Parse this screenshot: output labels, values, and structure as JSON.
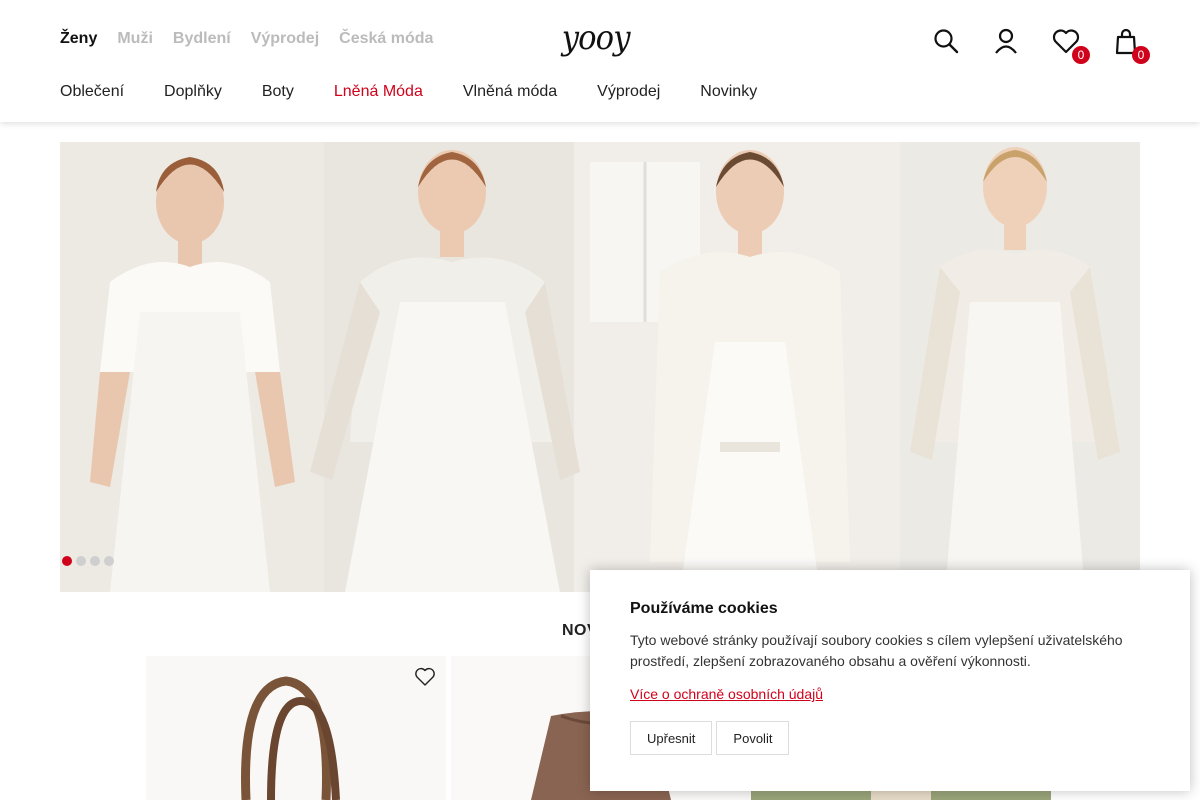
{
  "header": {
    "top_categories": [
      {
        "label": "Ženy",
        "active": true
      },
      {
        "label": "Muži",
        "active": false
      },
      {
        "label": "Bydlení",
        "active": false
      },
      {
        "label": "Výprodej",
        "active": false
      },
      {
        "label": "Česká móda",
        "active": false
      }
    ],
    "logo": "yooy",
    "icons": [
      {
        "name": "search-icon"
      },
      {
        "name": "user-icon"
      },
      {
        "name": "heart-icon",
        "count": "0"
      },
      {
        "name": "cart-icon",
        "count": "0"
      }
    ],
    "nav": [
      {
        "label": "Oblečení"
      },
      {
        "label": "Doplňky"
      },
      {
        "label": "Boty"
      },
      {
        "label": "Lněná Móda",
        "highlight": true
      },
      {
        "label": "Vlněná móda"
      },
      {
        "label": "Výprodej"
      },
      {
        "label": "Novinky"
      }
    ]
  },
  "hero": {
    "active_slide": 1,
    "slide_count": 4
  },
  "section": {
    "title": "NOV"
  },
  "cookie": {
    "title": "Používáme cookies",
    "text": "Tyto webové stránky používají soubory cookies s cílem vylepšení uživatelského prostředí, zlepšení zobrazovaného obsahu a ověření výkonnosti.",
    "link": "Více o ochraně osobních údajů",
    "refine_label": "Upřesnit",
    "allow_label": "Povolit"
  },
  "colors": {
    "accent": "#d0021b",
    "inactive_category": "#bbbbbb"
  }
}
